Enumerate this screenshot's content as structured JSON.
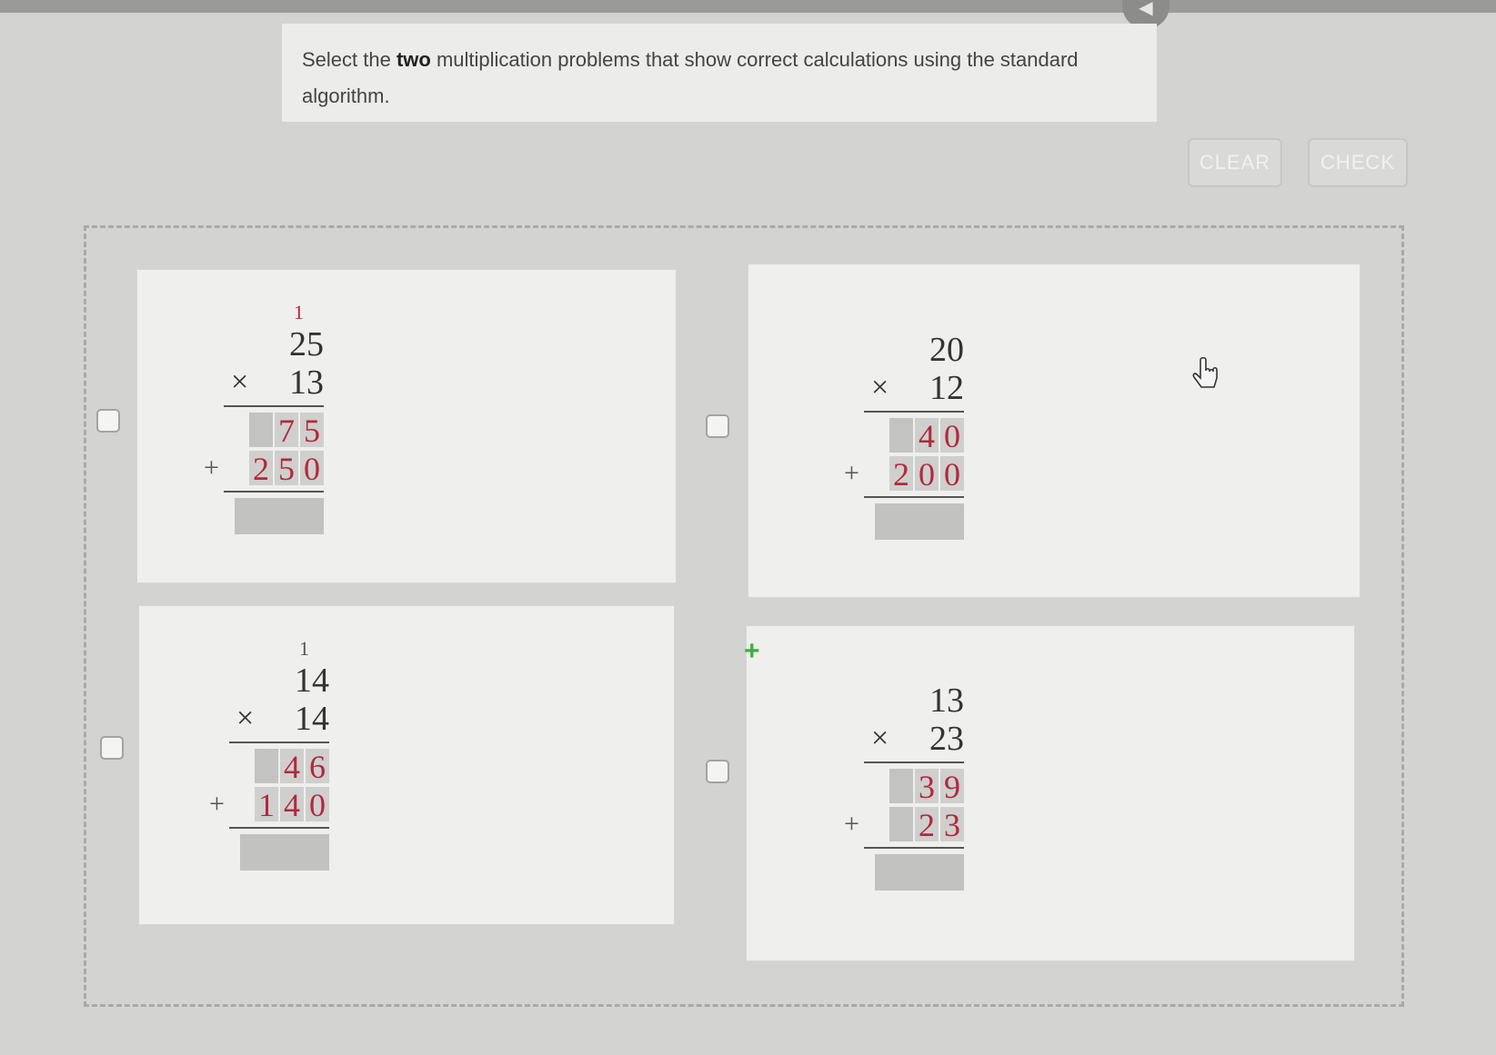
{
  "header": {
    "speaker_icon": "speaker-icon"
  },
  "prompt": {
    "text_before": "Select the ",
    "bold": "two",
    "text_after": " multiplication problems that show correct calculations using the standard algorithm."
  },
  "buttons": {
    "clear": "CLEAR",
    "check": "CHECK"
  },
  "problems": [
    {
      "carry": "1",
      "top": "25",
      "bottom": "13",
      "partial1": [
        "",
        "7",
        "5"
      ],
      "partial2": [
        "2",
        "5",
        "0"
      ]
    },
    {
      "carry": "",
      "top": "20",
      "bottom": "12",
      "partial1": [
        "",
        "4",
        "0"
      ],
      "partial2": [
        "2",
        "0",
        "0"
      ]
    },
    {
      "carry": "1",
      "top": "14",
      "bottom": "14",
      "partial1": [
        "",
        "4",
        "6"
      ],
      "partial2": [
        "1",
        "4",
        "0"
      ]
    },
    {
      "carry": "",
      "top": "13",
      "bottom": "23",
      "partial1": [
        "",
        "3",
        "9"
      ],
      "partial2": [
        "",
        "2",
        "3"
      ]
    }
  ],
  "symbols": {
    "times": "×",
    "plus": "+"
  },
  "colors": {
    "accent": "#b02a3c",
    "background": "#d3d3d1",
    "card": "#efefed"
  }
}
